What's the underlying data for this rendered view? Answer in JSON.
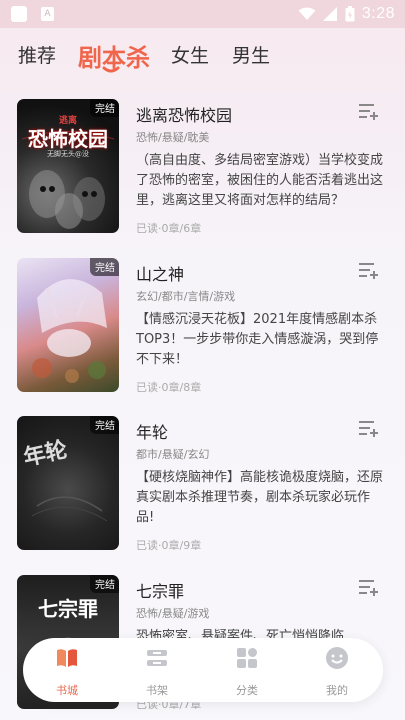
{
  "status_bar": {
    "time": "3:28",
    "left_icons": [
      "app-icon",
      "a-icon"
    ],
    "right_icons": [
      "wifi-icon",
      "signal-icon",
      "battery-icon"
    ]
  },
  "tabs": [
    {
      "label": "推荐",
      "active": false
    },
    {
      "label": "剧本杀",
      "active": true
    },
    {
      "label": "女生",
      "active": false
    },
    {
      "label": "男生",
      "active": false
    }
  ],
  "books": [
    {
      "title": "逃离恐怖校园",
      "tags": "恐怖/悬疑/耽美",
      "desc": "（高自由度、多结局密室游戏）当学校变成了恐怖的密室，被困住的人能否活着逃出这里，逃离这里又将面对怎样的结局？",
      "read": "已读·0章/6章",
      "badge": "完结",
      "cover_text": "恐怖校园",
      "cover_sub": "逃离",
      "cover_caption": "无脚无头@没"
    },
    {
      "title": "山之神",
      "tags": "玄幻/都市/言情/游戏",
      "desc": "【情感沉浸天花板】2021年度情感剧本杀TOP3！一步步带你走入情感漩涡，哭到停不下来！",
      "read": "已读·0章/8章",
      "badge": "完结"
    },
    {
      "title": "年轮",
      "tags": "都市/悬疑/玄幻",
      "desc": "【硬核烧脑神作】高能核诡极度烧脑，还原真实剧本杀推理节奏，剧本杀玩家必玩作品!",
      "read": "已读·0章/9章",
      "badge": "完结",
      "cover_text": "年轮"
    },
    {
      "title": "七宗罪",
      "tags": "恐怖/悬疑/游戏",
      "desc": "恐怖密室、悬疑案件、死亡悄悄降临...",
      "read": "已读·0章/7章",
      "badge": "完结",
      "cover_text": "七宗罪"
    }
  ],
  "bottom_nav": [
    {
      "label": "书城",
      "icon": "book-open-icon",
      "active": true
    },
    {
      "label": "书架",
      "icon": "bookshelf-icon",
      "active": false
    },
    {
      "label": "分类",
      "icon": "category-grid-icon",
      "active": false
    },
    {
      "label": "我的",
      "icon": "profile-face-icon",
      "active": false
    }
  ],
  "colors": {
    "accent": "#f0664c",
    "status_bar": "#f0d6dd",
    "nav_active": "#e46a50"
  }
}
